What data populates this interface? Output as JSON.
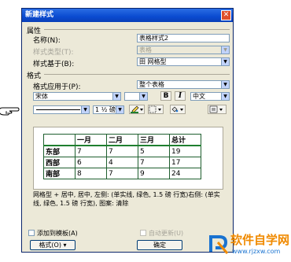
{
  "dialog": {
    "title": "新建样式",
    "close_glyph": "✕",
    "group_properties": "属性",
    "name_label": "名称(N):",
    "name_value": "表格样式2",
    "style_type_label": "样式类型(T):",
    "style_type_value": "表格",
    "based_on_label": "样式基于(B):",
    "based_on_value": "田 网格型",
    "group_format": "格式",
    "apply_to_label": "格式应用于(P):",
    "apply_to_value": "整个表格",
    "font_value": "宋体",
    "bold_label": "B",
    "italic_label": "I",
    "lang_value": "中文",
    "line_width_value": "1 ½ 磅",
    "preview_table": {
      "headers": [
        "",
        "一月",
        "二月",
        "三月",
        "总计"
      ],
      "rows": [
        [
          "东部",
          "7",
          "7",
          "5",
          "19"
        ],
        [
          "西部",
          "6",
          "4",
          "7",
          "17"
        ],
        [
          "南部",
          "8",
          "7",
          "9",
          "24"
        ]
      ]
    },
    "description": "网格型 + 居中, 居中, 左侧: (单实线, 绿色, 1.5 磅 行宽)右侧: (单实线, 绿色, 1.5 磅 行宽), 图案: 清除",
    "add_template_label": "添加到模板(A)",
    "auto_update_label": "自动更新(U)",
    "format_button_label": "格式(O) ▾",
    "ok_button_label": "确定"
  },
  "watermark": {
    "brand": "软件自学网",
    "url": "www.rjzxw.com"
  },
  "colors": {
    "border_green": "#1f7f2f",
    "title_blue": "#0a4bd0",
    "brand_orange": "#f08a00",
    "brand_blue": "#1a73d0"
  }
}
